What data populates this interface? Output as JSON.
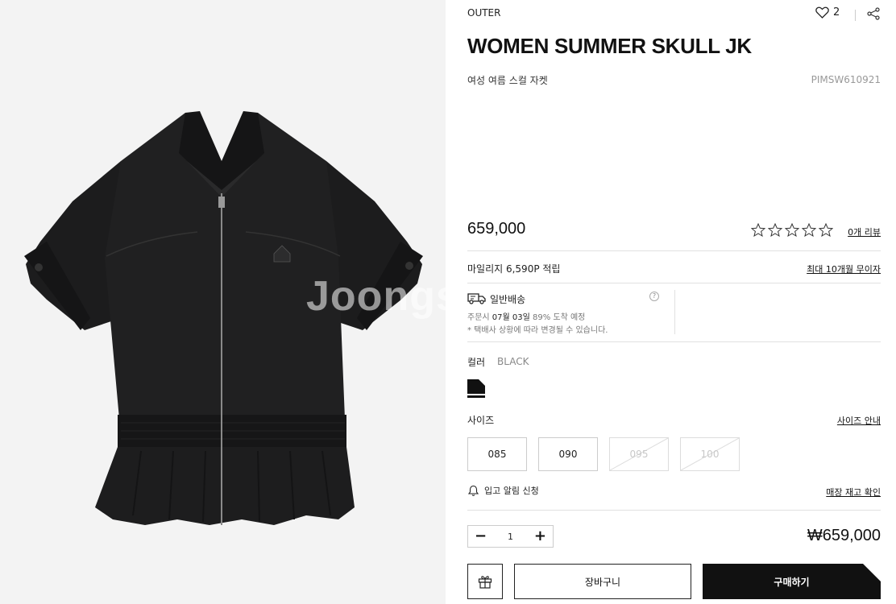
{
  "image": {
    "watermark": "Joongs",
    "colors": {
      "background": "#f3f3f3",
      "garment": "#1b1b1c"
    }
  },
  "product": {
    "category": "OUTER",
    "like_count": "2",
    "title": "WOMEN SUMMER SKULL JK",
    "subtitle": "여성 여름 스컬 자켓",
    "code": "PIMSW610921",
    "price": "659,000",
    "rating": 0,
    "review_link": "0개 리뷰",
    "mileage": "마일리지 6,590P 적립",
    "installment": "최대 10개월 무이자"
  },
  "shipping": {
    "title": "일반배송",
    "help": "?",
    "line1_prefix": "주문시 ",
    "line1_date": "07월 03일",
    "line1_suffix": " 89% 도착 예정",
    "line2": "* 택배사 상황에 따라 변경될 수 있습니다."
  },
  "options": {
    "color_label": "컬러",
    "color_value": "BLACK",
    "swatch_color": "#111111",
    "size_label": "사이즈",
    "size_guide": "사이즈 안내",
    "sizes": [
      {
        "label": "085",
        "sold_out": false
      },
      {
        "label": "090",
        "sold_out": false
      },
      {
        "label": "095",
        "sold_out": true
      },
      {
        "label": "100",
        "sold_out": true
      }
    ],
    "alarm": "입고 알림 신청",
    "stock_check": "매장 재고 확인"
  },
  "purchase": {
    "minus": "−",
    "quantity": "1",
    "plus": "+",
    "total": "₩659,000",
    "cart_label": "장바구니",
    "buy_label": "구매하기"
  },
  "icons": {
    "like": "heart-icon",
    "share": "share-icon",
    "star": "star-outline-icon",
    "shipping": "truck-icon",
    "help": "help-icon",
    "alarm": "bell-icon",
    "gift": "gift-icon"
  }
}
